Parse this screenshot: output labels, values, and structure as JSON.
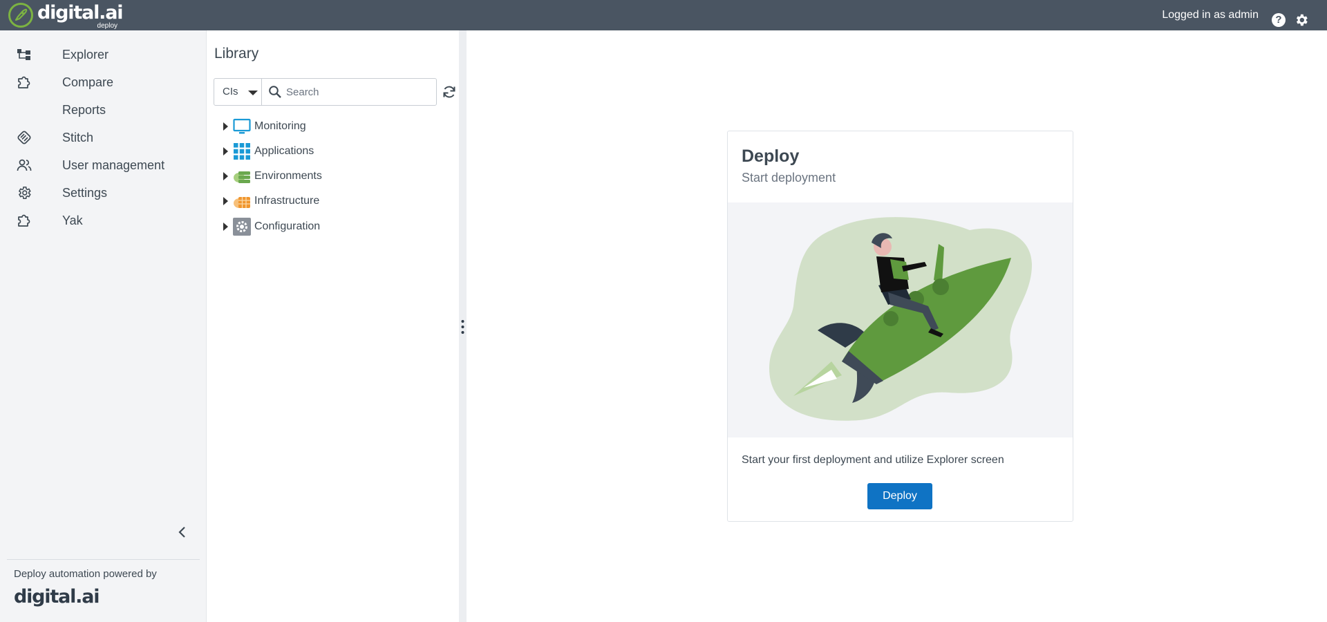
{
  "header": {
    "logo_text": "digital.ai",
    "logo_subtext": "deploy",
    "user_label": "Logged in as admin",
    "help_icon": "?"
  },
  "sidebar": {
    "items": [
      {
        "label": "Explorer",
        "icon": "explorer-icon"
      },
      {
        "label": "Compare",
        "icon": "puzzle-icon"
      },
      {
        "label": "Reports",
        "icon": ""
      },
      {
        "label": "Stitch",
        "icon": "stitch-icon"
      },
      {
        "label": "User management",
        "icon": "users-icon"
      },
      {
        "label": "Settings",
        "icon": "gear-icon"
      },
      {
        "label": "Yak",
        "icon": "puzzle-icon"
      }
    ],
    "powered_by": "Deploy automation powered by",
    "footer_logo": "digital.ai"
  },
  "library": {
    "title": "Library",
    "type_select": "CIs",
    "search_placeholder": "Search",
    "tree": [
      {
        "label": "Monitoring",
        "icon": "monitor-icon"
      },
      {
        "label": "Applications",
        "icon": "grid-icon"
      },
      {
        "label": "Environments",
        "icon": "environment-icon"
      },
      {
        "label": "Infrastructure",
        "icon": "infrastructure-icon"
      },
      {
        "label": "Configuration",
        "icon": "configuration-icon"
      }
    ]
  },
  "card": {
    "title": "Deploy",
    "subtitle": "Start deployment",
    "description": "Start your first deployment and utilize Explorer screen",
    "button_label": "Deploy"
  },
  "colors": {
    "topbar": "#4a5562",
    "accent_green": "#7cb342",
    "primary_button": "#0f73c4",
    "sidebar_bg": "#f3f4f6"
  }
}
